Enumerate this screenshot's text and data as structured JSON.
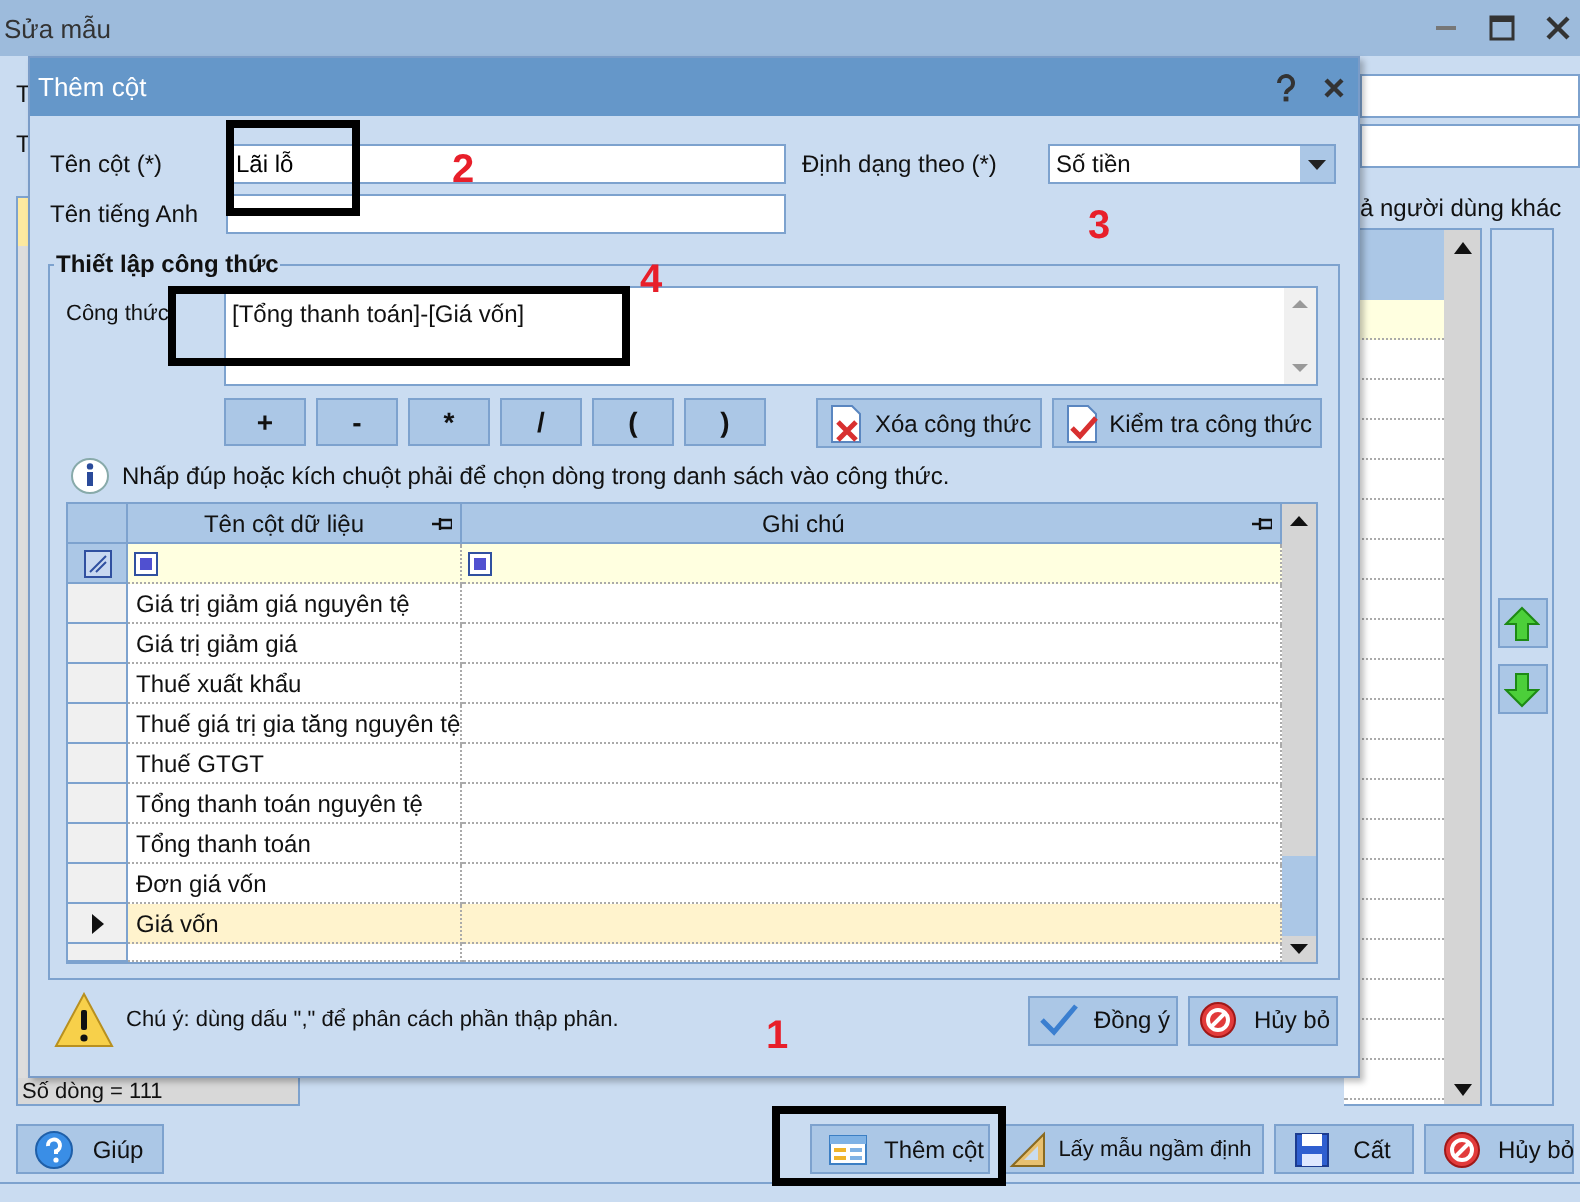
{
  "window": {
    "title": "Sửa mẫu"
  },
  "background": {
    "field_labels": [
      "T",
      "T"
    ],
    "share_text": "ả người dùng khác",
    "row_count": "Số dòng = 111"
  },
  "dialog": {
    "title": "Thêm cột",
    "fields": [
      {
        "label": "Tên cột (*)",
        "value": "Lãi lỗ"
      },
      {
        "label": "Tên tiếng Anh"
      }
    ],
    "format": {
      "label": "Định dạng theo (*)",
      "value": "Số tiền"
    },
    "formula_group": {
      "title": "Thiết lập công thức",
      "label": "Công thức",
      "value": "[Tổng thanh toán]-[Giá vốn]",
      "operators": [
        "+",
        "-",
        "*",
        "/",
        "(",
        ")"
      ],
      "actions": [
        {
          "label": "Xóa công thức",
          "kind": "clear"
        },
        {
          "label": "Kiểm tra công thức",
          "kind": "check"
        }
      ],
      "hint": "Nhấp đúp hoặc kích chuột phải để chọn dòng trong danh sách vào công thức.",
      "table": {
        "columns": [
          "Tên cột dữ liệu",
          "Ghi chú"
        ],
        "rows": [
          {
            "name": "Giá trị giảm giá nguyên tệ",
            "selected": false
          },
          {
            "name": "Giá trị giảm giá",
            "selected": false
          },
          {
            "name": "Thuế xuất khẩu",
            "selected": false
          },
          {
            "name": "Thuế giá trị gia tăng nguyên tệ",
            "selected": false
          },
          {
            "name": "Thuế GTGT",
            "selected": false
          },
          {
            "name": "Tổng thanh toán nguyên tệ",
            "selected": false
          },
          {
            "name": "Tổng thanh toán",
            "selected": false
          },
          {
            "name": "Đơn giá vốn",
            "selected": false
          },
          {
            "name": "Giá vốn",
            "selected": true
          }
        ]
      }
    },
    "note": "Chú ý: dùng dấu \",\" để phân cách phần thập phân.",
    "buttons": [
      {
        "label": "Đồng ý",
        "kind": "ok"
      },
      {
        "label": "Hủy bỏ",
        "kind": "cancel"
      }
    ]
  },
  "bottom_buttons": [
    {
      "label": "Giúp",
      "kind": "help"
    },
    {
      "label": "Thêm cột",
      "kind": "add-column"
    },
    {
      "label": "Lấy mẫu ngầm định",
      "kind": "default"
    },
    {
      "label": "Cất",
      "kind": "save"
    },
    {
      "label": "Hủy bỏ",
      "kind": "cancel"
    }
  ],
  "annotations": [
    "2",
    "3",
    "4",
    "1"
  ]
}
